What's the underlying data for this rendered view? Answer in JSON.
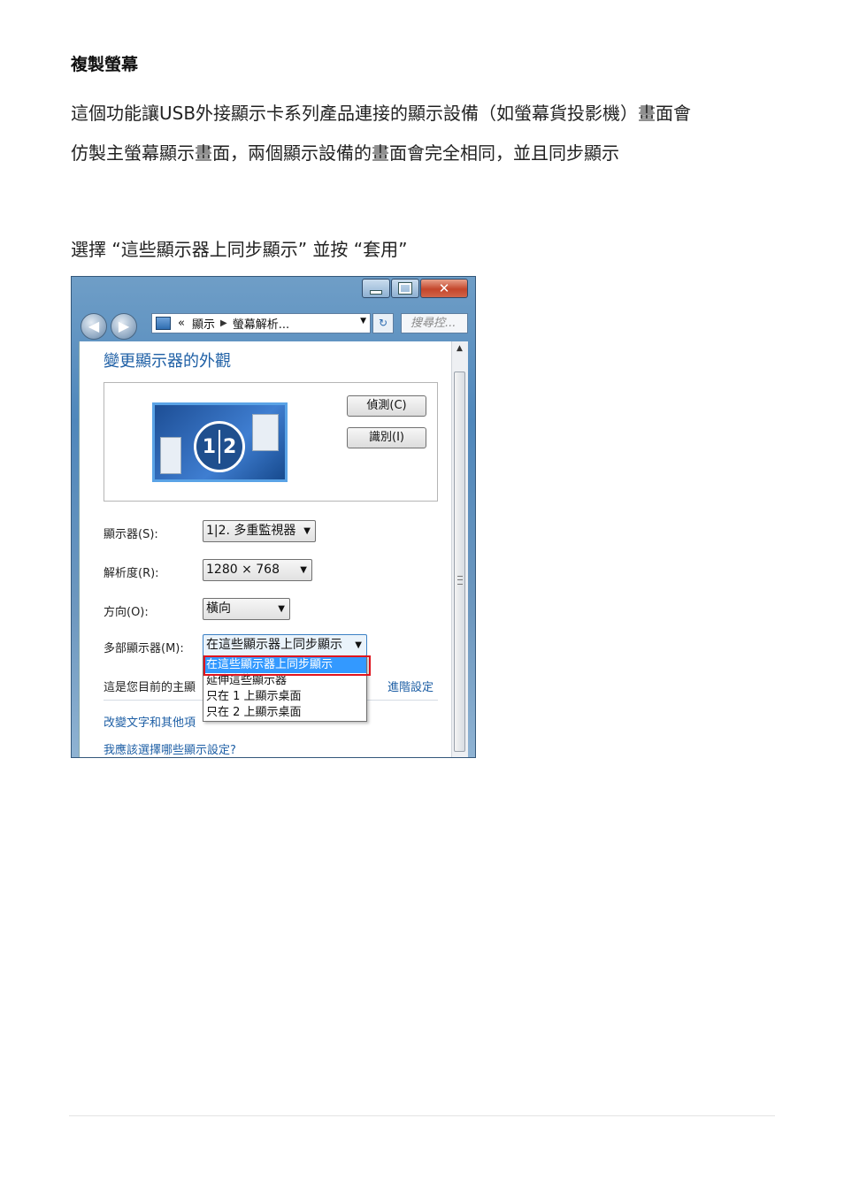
{
  "heading": "複製螢幕",
  "paragraph": {
    "line1": "這個功能讓USB外接顯示卡系列產品連接的顯示設備（如螢幕貨投影機）畫面會",
    "line2": "仿製主螢幕顯示畫面，兩個顯示設備的畫面會完全相同，並且同步顯示"
  },
  "instruction": "選擇 “這些顯示器上同步顯示” 並按 “套用”",
  "window": {
    "address": {
      "root": "«",
      "crumb1": "顯示",
      "crumb2": "螢幕解析..."
    },
    "search_placeholder": "搜尋控..."
  },
  "dialog": {
    "title": "變更顯示器的外觀",
    "monitor_numbers": [
      "1",
      "2"
    ],
    "detect_button": "偵測(C)",
    "identify_button": "識別(I)",
    "display_label": "顯示器(S):",
    "display_value": "1|2. 多重監視器",
    "resolution_label": "解析度(R):",
    "resolution_value": "1280 × 768",
    "orientation_label": "方向(O):",
    "orientation_value": "橫向",
    "multi_label": "多部顯示器(M):",
    "multi_value": "在這些顯示器上同步顯示",
    "multi_options": [
      "在這些顯示器上同步顯示",
      "延伸這些顯示器",
      "只在 1 上顯示桌面",
      "只在 2 上顯示桌面"
    ],
    "primary_text": "這是您目前的主顯",
    "advanced_link": "進階設定",
    "link_text_size": "改變文字和其他項",
    "link_which_settings": "我應該選擇哪些顯示設定?"
  },
  "colors": {
    "link": "#1e5fa5",
    "highlight": "#e0141e",
    "selection": "#3399ff"
  }
}
